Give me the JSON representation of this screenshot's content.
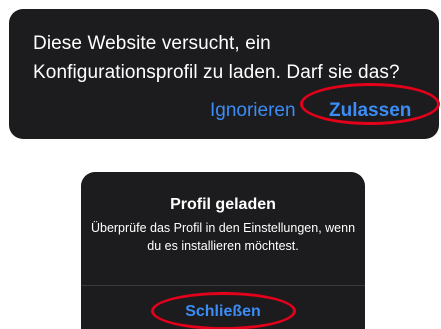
{
  "confirm_dialog": {
    "message": "Diese Website versucht, ein Konfigurationsprofil zu laden. Darf sie das?",
    "ignore_label": "Ignorieren",
    "allow_label": "Zulassen"
  },
  "loaded_dialog": {
    "title": "Profil geladen",
    "body": "Überprüfe das Profil in den Einstellungen, wenn du es installieren möchtest.",
    "close_label": "Schließen"
  },
  "colors": {
    "dialog_background": "#1c1c1e",
    "button_blue": "#3b8cf5",
    "highlight_red": "#e3001b"
  }
}
